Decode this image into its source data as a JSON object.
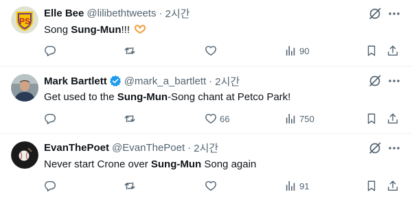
{
  "tweets": [
    {
      "name": "Elle Bee",
      "handle": "@lilibethtweets",
      "sep": "·",
      "time": "2시간",
      "text_before": "Song ",
      "text_bold": "Sung-Mun",
      "text_after": "!!!",
      "emoji": "heart-hands",
      "replies": "",
      "retweets": "",
      "likes": "",
      "views": "90",
      "avatar": "ps-badge"
    },
    {
      "name": "Mark Bartlett",
      "verified": true,
      "handle": "@mark_a_bartlett",
      "sep": "·",
      "time": "2시간",
      "text_before": "Get used to the ",
      "text_bold": "Sung-Mun",
      "text_after": "-Song chant at Petco Park!",
      "replies": "",
      "retweets": "",
      "likes": "66",
      "views": "750",
      "avatar": "person-photo"
    },
    {
      "name": "EvanThePoet",
      "handle": "@EvanThePoet",
      "sep": "·",
      "time": "2시간",
      "text_before": "Never start Crone over ",
      "text_bold": "Sung-Mun",
      "text_after": " Song again",
      "replies": "",
      "retweets": "",
      "likes": "",
      "views": "91",
      "avatar": "baseball-dark"
    }
  ],
  "colors": {
    "text": "#0f1419",
    "muted": "#536471",
    "verified": "#1d9bf0",
    "divider": "#eff3f4"
  }
}
